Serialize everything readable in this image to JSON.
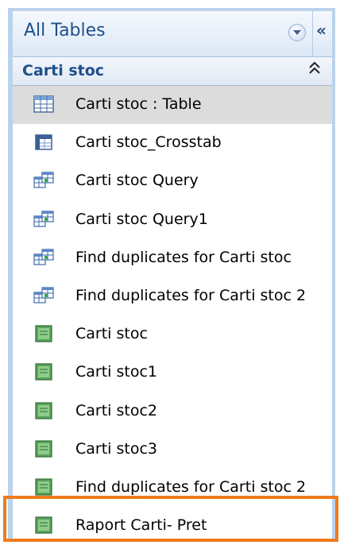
{
  "header": {
    "title": "All Tables",
    "dropdown_icon": "chevron-down-icon",
    "collapse_label": "«"
  },
  "group": {
    "title": "Carti stoc",
    "toggle_label": "≈"
  },
  "items": [
    {
      "label": "Carti stoc : Table",
      "icon": "table-icon",
      "selected": true
    },
    {
      "label": "Carti stoc_Crosstab",
      "icon": "crosstab-query-icon",
      "selected": false
    },
    {
      "label": "Carti stoc Query",
      "icon": "select-query-icon",
      "selected": false
    },
    {
      "label": "Carti stoc Query1",
      "icon": "select-query-icon",
      "selected": false
    },
    {
      "label": "Find duplicates for Carti stoc",
      "icon": "select-query-icon",
      "selected": false
    },
    {
      "label": "Find duplicates for Carti stoc 2",
      "icon": "select-query-icon",
      "selected": false
    },
    {
      "label": "Carti stoc",
      "icon": "form-icon",
      "selected": false
    },
    {
      "label": "Carti stoc1",
      "icon": "form-icon",
      "selected": false
    },
    {
      "label": "Carti stoc2",
      "icon": "form-icon",
      "selected": false
    },
    {
      "label": "Carti stoc3",
      "icon": "form-icon",
      "selected": false
    },
    {
      "label": "Find duplicates for Carti stoc 2",
      "icon": "form-icon",
      "selected": false
    },
    {
      "label": "Raport Carti- Pret",
      "icon": "report-icon",
      "selected": false
    }
  ],
  "colors": {
    "accent_title": "#1f4f8c",
    "selection": "#dcdcdc",
    "highlight_border": "#f07b1c"
  }
}
